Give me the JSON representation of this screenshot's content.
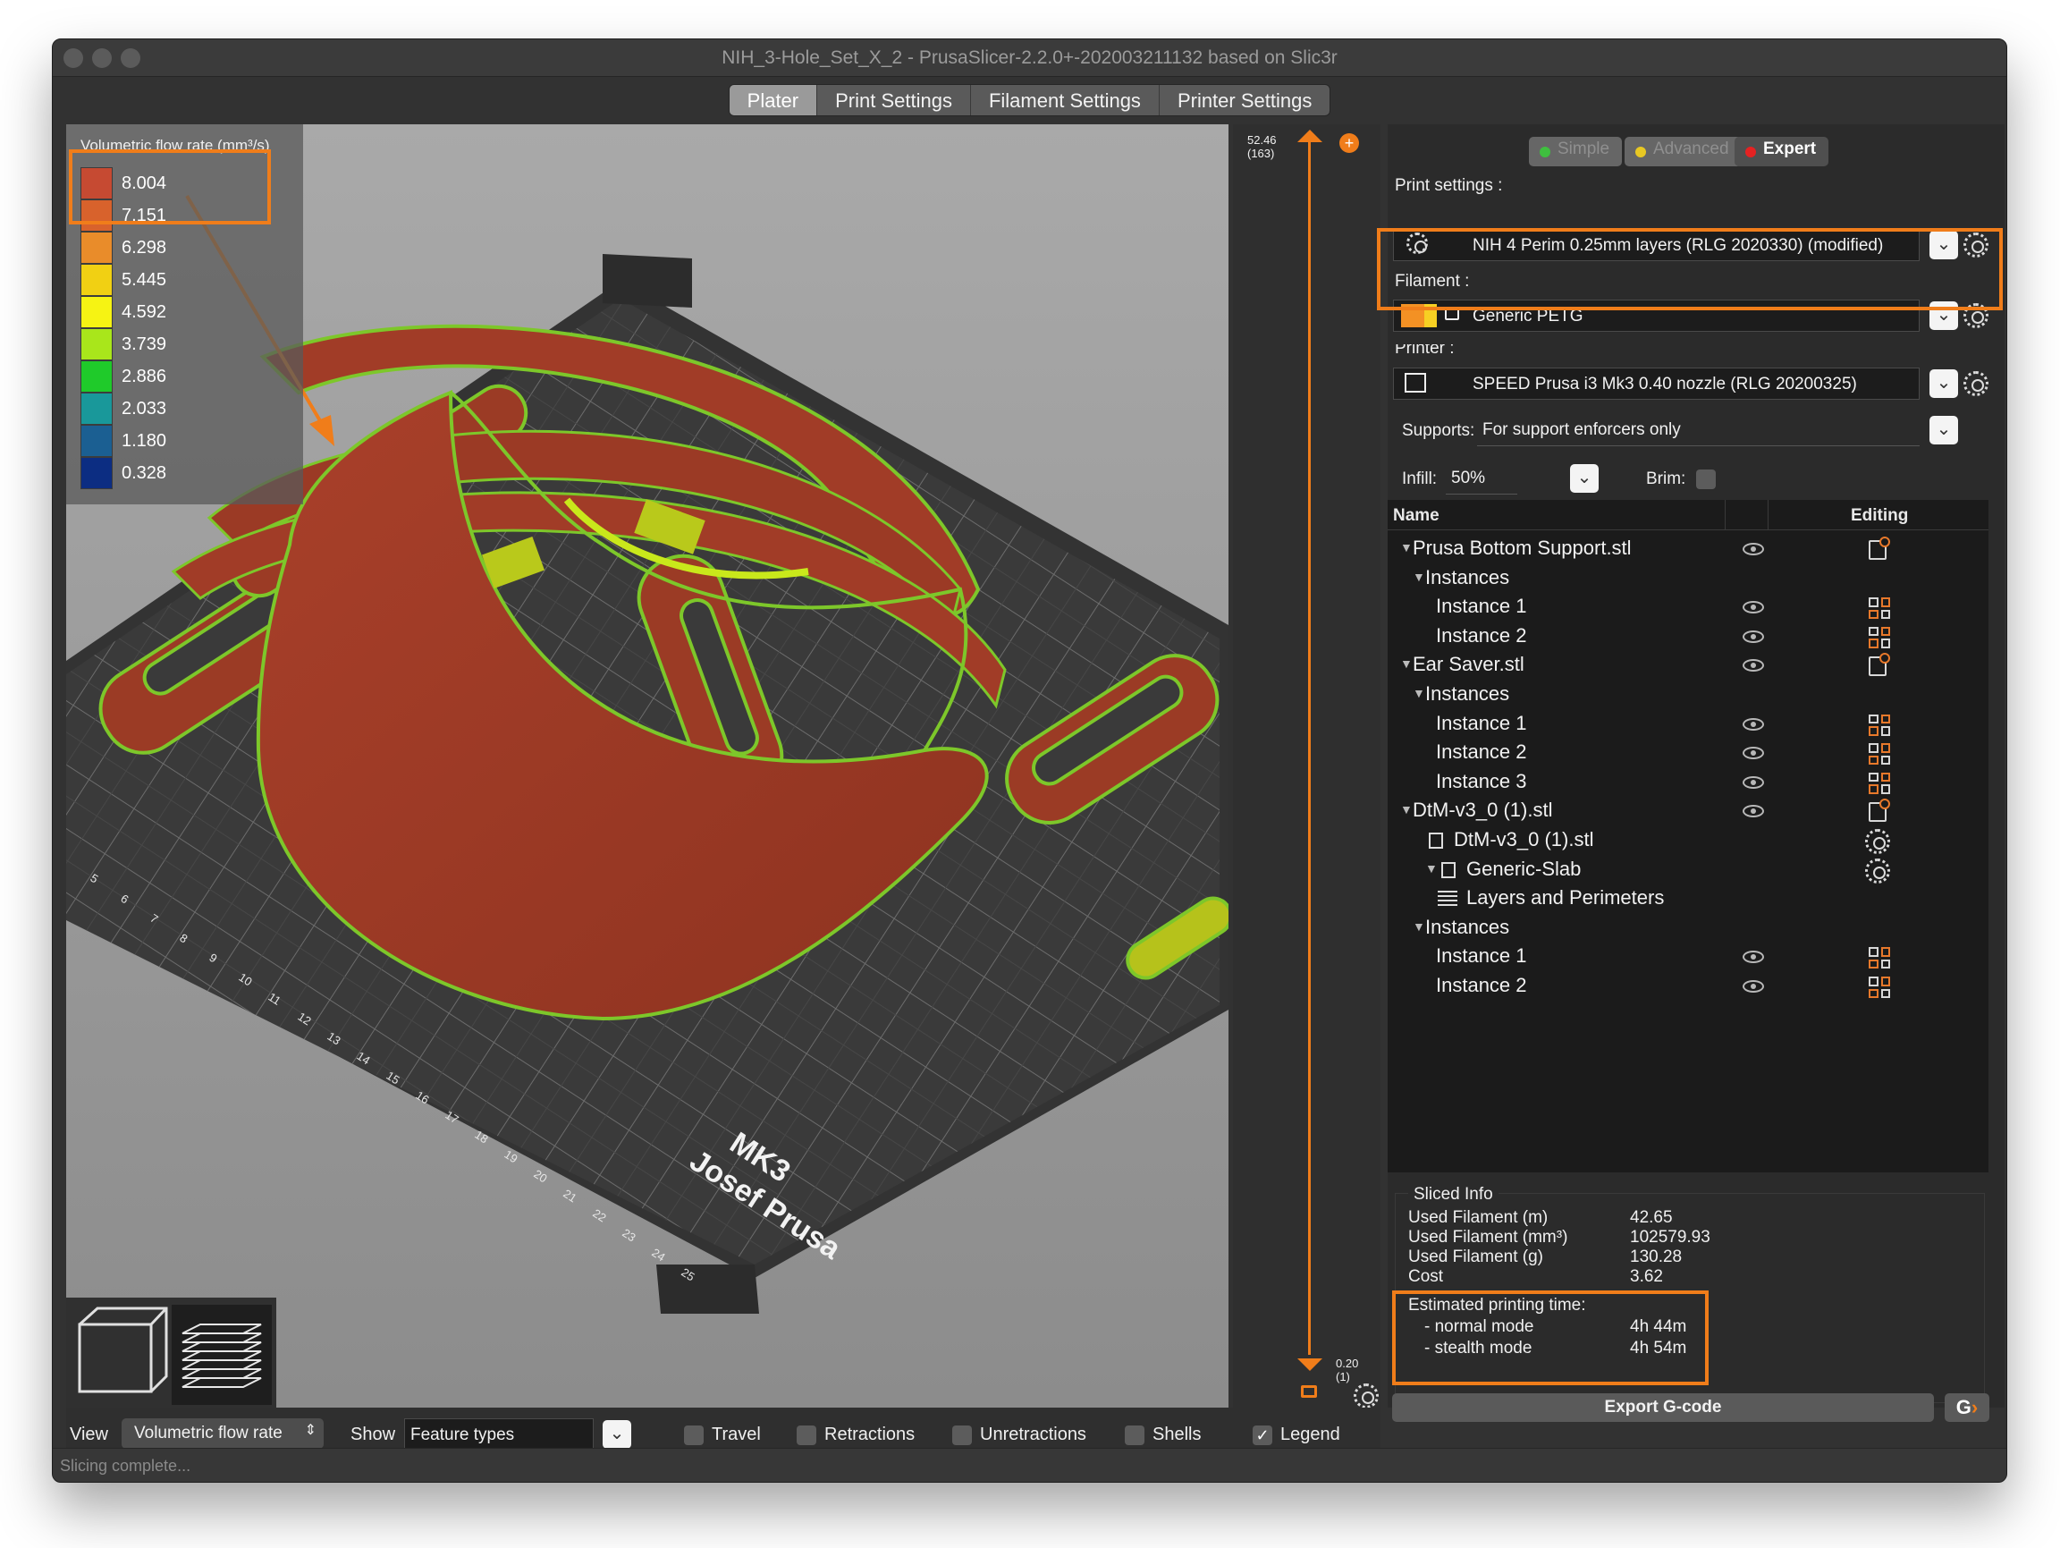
{
  "window": {
    "title": "NIH_3-Hole_Set_X_2 - PrusaSlicer-2.2.0+-202003211132 based on Slic3r"
  },
  "tabs": [
    {
      "label": "Plater",
      "active": true
    },
    {
      "label": "Print Settings",
      "active": false
    },
    {
      "label": "Filament Settings",
      "active": false
    },
    {
      "label": "Printer Settings",
      "active": false
    }
  ],
  "legend": {
    "title": "Volumetric flow rate (mm³/s)",
    "items": [
      {
        "value": "8.004",
        "color": "#c64a32"
      },
      {
        "value": "7.151",
        "color": "#d8622c"
      },
      {
        "value": "6.298",
        "color": "#e98c2a"
      },
      {
        "value": "5.445",
        "color": "#f1d013"
      },
      {
        "value": "4.592",
        "color": "#f6f313"
      },
      {
        "value": "3.739",
        "color": "#a9e61b"
      },
      {
        "value": "2.886",
        "color": "#1fca2a"
      },
      {
        "value": "2.033",
        "color": "#19989a"
      },
      {
        "value": "1.180",
        "color": "#1b5f92"
      },
      {
        "value": "0.328",
        "color": "#0c2d82"
      }
    ]
  },
  "layer_slider": {
    "top_value": "52.46",
    "top_layer": "(163)",
    "bottom_value": "0.20",
    "bottom_layer": "(1)"
  },
  "mode_buttons": [
    {
      "label": "Simple",
      "color": "#3fbf3f"
    },
    {
      "label": "Advanced",
      "color": "#e8c823"
    },
    {
      "label": "Expert",
      "color": "#e52222"
    }
  ],
  "print_settings": {
    "label": "Print settings :",
    "value": "NIH 4 Perim 0.25mm layers (RLG 2020330) (modified)"
  },
  "filament": {
    "label": "Filament :",
    "value": "Generic PETG",
    "color": "#f39124"
  },
  "printer": {
    "label": "Printer :",
    "value": "SPEED Prusa i3 Mk3 0.40 nozzle (RLG 20200325)"
  },
  "supports": {
    "label": "Supports:",
    "value": "For support enforcers only"
  },
  "infill": {
    "label": "Infill:",
    "value": "50%"
  },
  "brim": {
    "label": "Brim:"
  },
  "tree": {
    "col_name": "Name",
    "col_editing": "Editing",
    "rows": [
      {
        "label": "Prusa Bottom Support.stl",
        "kind": "object"
      },
      {
        "label": "Instances",
        "kind": "group"
      },
      {
        "label": "Instance 1",
        "kind": "instance"
      },
      {
        "label": "Instance 2",
        "kind": "instance"
      },
      {
        "label": "Ear Saver.stl",
        "kind": "object"
      },
      {
        "label": "Instances",
        "kind": "group"
      },
      {
        "label": "Instance 1",
        "kind": "instance"
      },
      {
        "label": "Instance 2",
        "kind": "instance"
      },
      {
        "label": "Instance 3",
        "kind": "instance"
      },
      {
        "label": "DtM-v3_0 (1).stl",
        "kind": "object"
      },
      {
        "label": "DtM-v3_0 (1).stl",
        "kind": "part"
      },
      {
        "label": "Generic-Slab",
        "kind": "modifier"
      },
      {
        "label": "Layers and Perimeters",
        "kind": "setting"
      },
      {
        "label": "Instances",
        "kind": "group"
      },
      {
        "label": "Instance 1",
        "kind": "instance"
      },
      {
        "label": "Instance 2",
        "kind": "instance"
      }
    ]
  },
  "sliced_info": {
    "title": "Sliced Info",
    "rows": [
      {
        "label": "Used Filament (m)",
        "value": "42.65"
      },
      {
        "label": "Used Filament (mm³)",
        "value": "102579.93"
      },
      {
        "label": "Used Filament (g)",
        "value": "130.28"
      },
      {
        "label": "Cost",
        "value": "3.62"
      }
    ],
    "time_label": "Estimated printing time:",
    "normal_label": "- normal mode",
    "normal_value": "4h 44m",
    "stealth_label": "- stealth mode",
    "stealth_value": "4h 54m"
  },
  "export_button": "Export G-code",
  "bottom_bar": {
    "view_label": "View",
    "view_value": "Volumetric flow rate",
    "show_label": "Show",
    "show_value": "Feature types",
    "checkboxes": [
      {
        "label": "Travel",
        "checked": false
      },
      {
        "label": "Retractions",
        "checked": false
      },
      {
        "label": "Unretractions",
        "checked": false
      },
      {
        "label": "Shells",
        "checked": false
      },
      {
        "label": "Legend",
        "checked": true
      }
    ]
  },
  "bed_text": {
    "line1": "MK3",
    "line2": "Josef Prusa"
  },
  "bed_ticks": [
    "5",
    "6",
    "7",
    "8",
    "9",
    "10",
    "11",
    "12",
    "13",
    "14",
    "15",
    "16",
    "17",
    "18",
    "19",
    "20",
    "21",
    "22",
    "23",
    "24",
    "25"
  ],
  "status": "Slicing complete..."
}
